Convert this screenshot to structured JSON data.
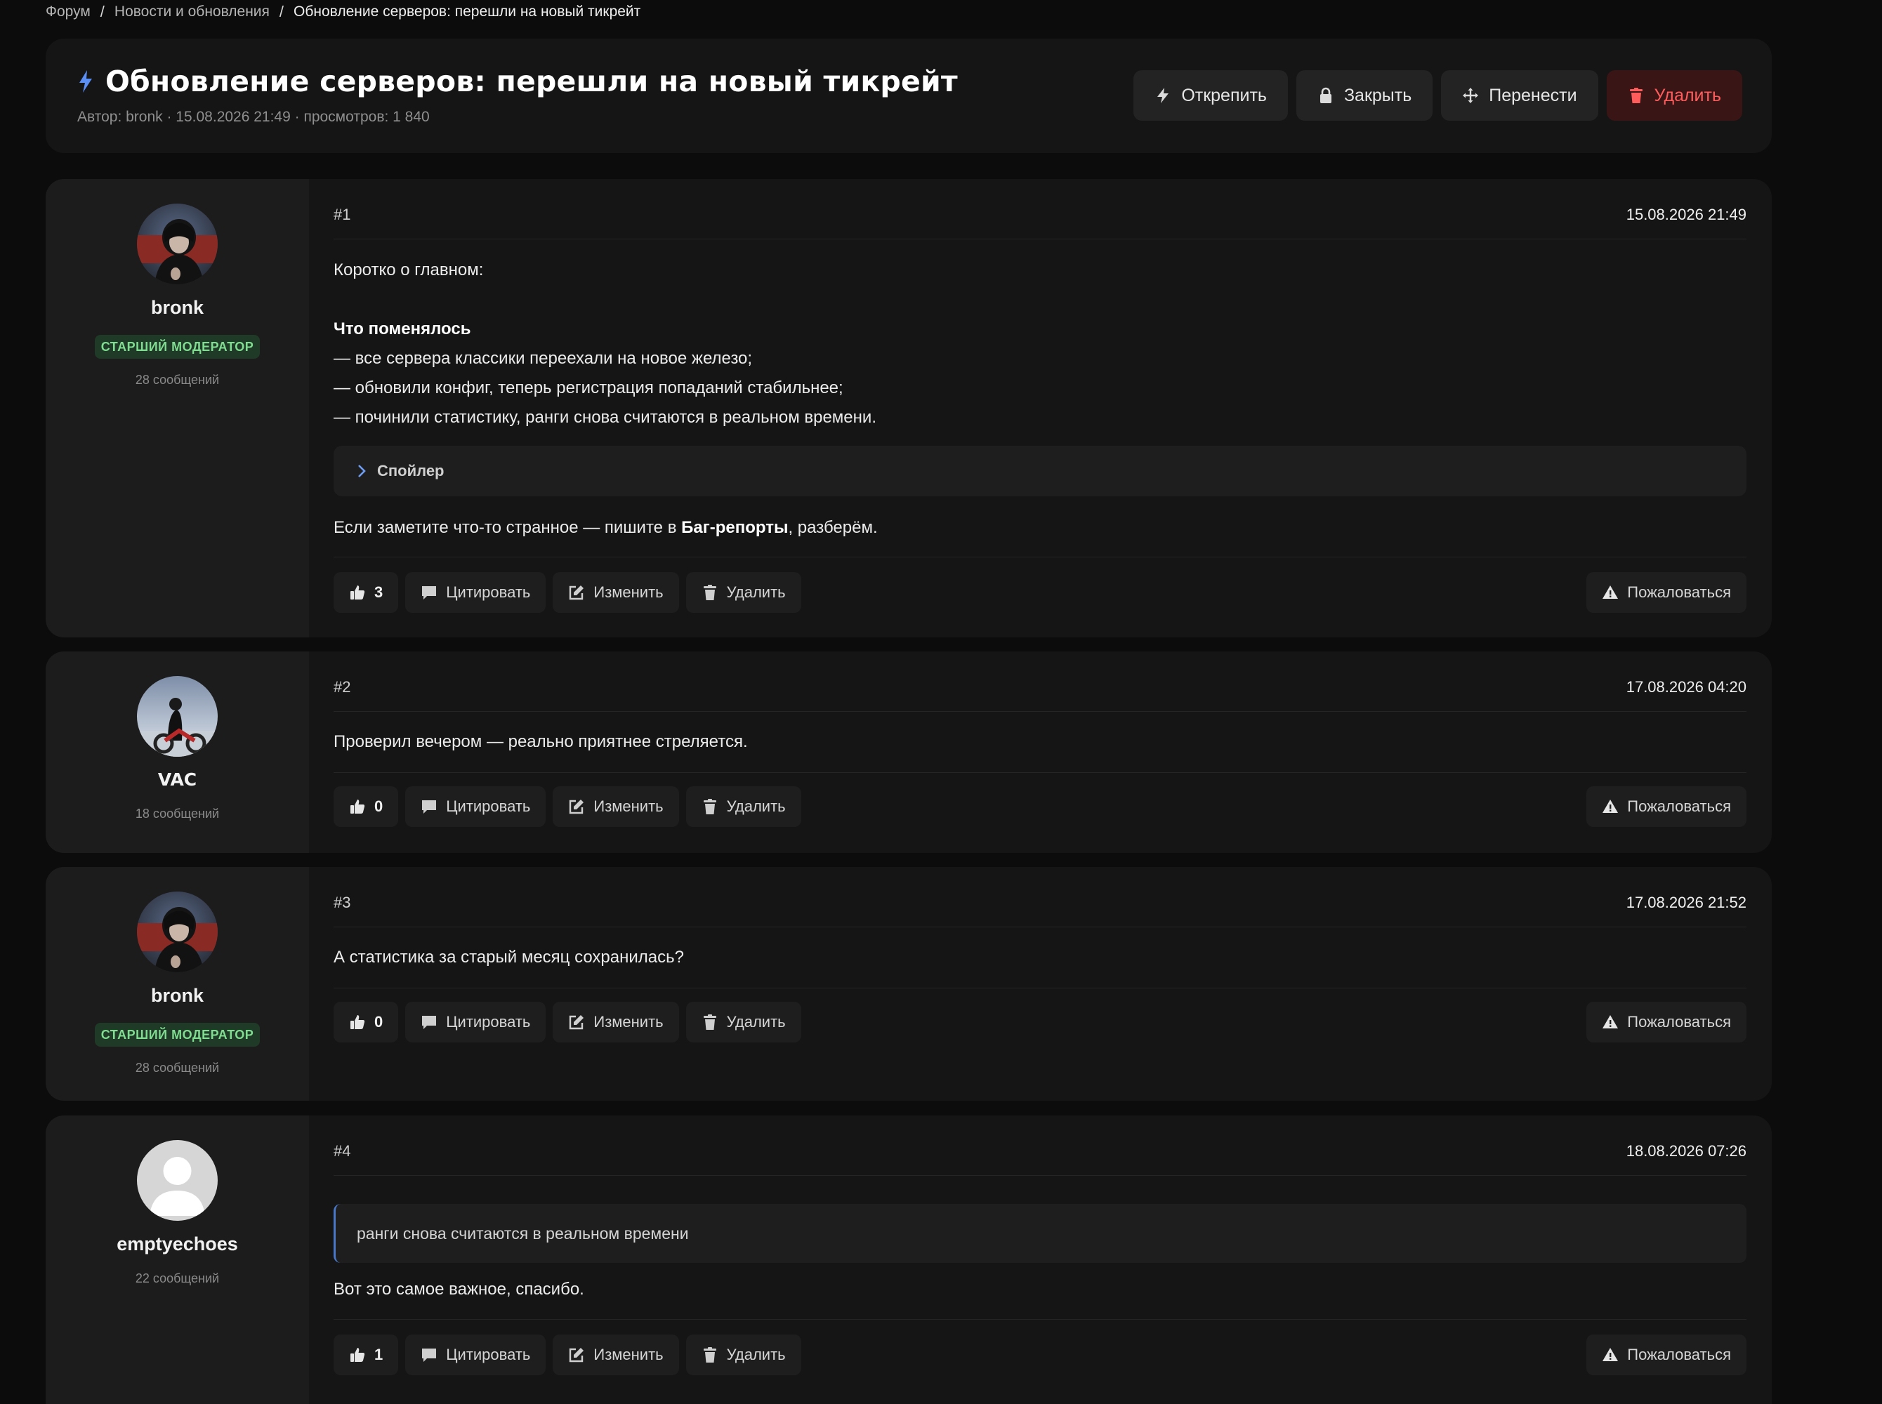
{
  "breadcrumb": {
    "items": [
      "Форум",
      "Новости и обновления",
      "Обновление серверов: перешли на новый тикрейт"
    ],
    "separator": "/"
  },
  "thread": {
    "title": "Обновление серверов: перешли на новый тикрейт",
    "meta": "Автор: bronk · 15.08.2026 21:49 · просмотров: 1 840",
    "actions": {
      "unpin": "Открепить",
      "close": "Закрыть",
      "move": "Перенести",
      "delete": "Удалить"
    }
  },
  "labels": {
    "quote": "Цитировать",
    "edit": "Изменить",
    "delete": "Удалить",
    "report": "Пожаловаться",
    "spoiler": "Спойлер"
  },
  "posts": [
    {
      "num": "#1",
      "date": "15.08.2026 21:49",
      "author": "bronk",
      "role": "СТАРШИЙ МОДЕРАТОР",
      "messages": "28 сообщений",
      "likes": "3",
      "intro": "Коротко о главном:",
      "heading": "Что поменялось",
      "lines": [
        "— все сервера классики переехали на новое железо;",
        "— обновили конфиг, теперь регистрация попаданий стабильнее;",
        "— починили статистику, ранги снова считаются в реальном времени."
      ],
      "outro_pre": "Если заметите что-то странное — пишите в ",
      "outro_bold": "Баг-репорты",
      "outro_post": ", разберём."
    },
    {
      "num": "#2",
      "date": "17.08.2026 04:20",
      "author": "VAC",
      "messages": "18 сообщений",
      "likes": "0",
      "text": "Проверил вечером — реально приятнее стреляется."
    },
    {
      "num": "#3",
      "date": "17.08.2026 21:52",
      "author": "bronk",
      "role": "СТАРШИЙ МОДЕРАТОР",
      "messages": "28 сообщений",
      "likes": "0",
      "text": "А статистика за старый месяц сохранилась?"
    },
    {
      "num": "#4",
      "date": "18.08.2026 07:26",
      "author": "emptyechoes",
      "messages": "22 сообщений",
      "likes": "1",
      "quote": "ранги снова считаются в реальном времени",
      "text": "Вот это самое важное, спасибо."
    }
  ],
  "colors": {
    "background": "#0c0c0c",
    "card": "#151515",
    "sidebar": "#1c1c1c",
    "danger": "#ff5c5c",
    "role_badge": "#7fdc90",
    "accent": "#4a78c8"
  }
}
